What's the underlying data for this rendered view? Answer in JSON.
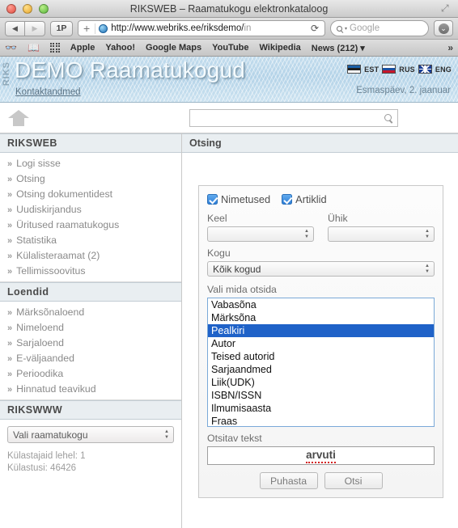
{
  "window": {
    "title": "RIKSWEB – Raamatukogu elektronkataloog",
    "fullscreen_icon": "expand-icon"
  },
  "browser": {
    "back_label": "◀",
    "forward_label": "▶",
    "tab_overview_label": "1P",
    "new_tab_label": "+",
    "url": "http://www.webriks.ee/riksdemo/",
    "url_dim": "in",
    "reload_label": "⟳",
    "search_placeholder": "Google",
    "download_label": "⌄",
    "bookmarks": [
      "Apple",
      "Yahoo!",
      "Google Maps",
      "YouTube",
      "Wikipedia",
      "News (212) ▾"
    ],
    "overflow_label": "»"
  },
  "site": {
    "watermark": "RIKS",
    "title": "DEMO Raamatukogud",
    "contact_link": "Kontaktandmed",
    "date": "Esmaspäev, 2. jaanuar",
    "languages": [
      {
        "code": "est",
        "label": "EST"
      },
      {
        "code": "rus",
        "label": "RUS"
      },
      {
        "code": "eng",
        "label": "ENG"
      }
    ],
    "top_search_value": ""
  },
  "sidebar": {
    "section1_title": "RIKSWEB",
    "section1_items": [
      "Logi sisse",
      "Otsing",
      "Otsing dokumentidest",
      "Uudiskirjandus",
      "Üritused raamatukogus",
      "Statistika",
      "Külalisteraamat (2)",
      "Tellimissoovitus"
    ],
    "section2_title": "Loendid",
    "section2_items": [
      "Märksõnaloend",
      "Nimeloend",
      "Sarjaloend",
      "E-väljaanded",
      "Perioodika",
      "Hinnatud teavikud"
    ],
    "section3_title": "RIKSWWW",
    "library_select_value": "Vali raamatukogu",
    "visitors_line": "Külastajaid lehel: 1",
    "visits_line": "Külastusi: 46426",
    "bullet": "»"
  },
  "main": {
    "panel_title": "Otsing",
    "checkbox_nimetused": "Nimetused",
    "checkbox_artiklid": "Artiklid",
    "label_keel": "Keel",
    "label_yhik": "Ühik",
    "label_kogu": "Kogu",
    "value_keel": "",
    "value_yhik": "",
    "value_kogu": "Kõik kogud",
    "label_vali": "Vali mida otsida",
    "list_options": [
      "Vabasõna",
      "Märksõna",
      "Pealkiri",
      "Autor",
      "Teised autorid",
      "Sarjaandmed",
      "Liik(UDK)",
      "ISBN/ISSN",
      "Ilmumisaasta",
      "Fraas"
    ],
    "list_selected": "Pealkiri",
    "label_otsitav": "Otsitav tekst",
    "search_value": "arvuti",
    "btn_clear": "Puhasta",
    "btn_search": "Otsi"
  },
  "colors": {
    "selection_blue": "#1f62c8",
    "checkbox_blue": "#2f7fd8",
    "spellcheck_red": "#d32020",
    "header_blue": "#b4d3e8"
  }
}
